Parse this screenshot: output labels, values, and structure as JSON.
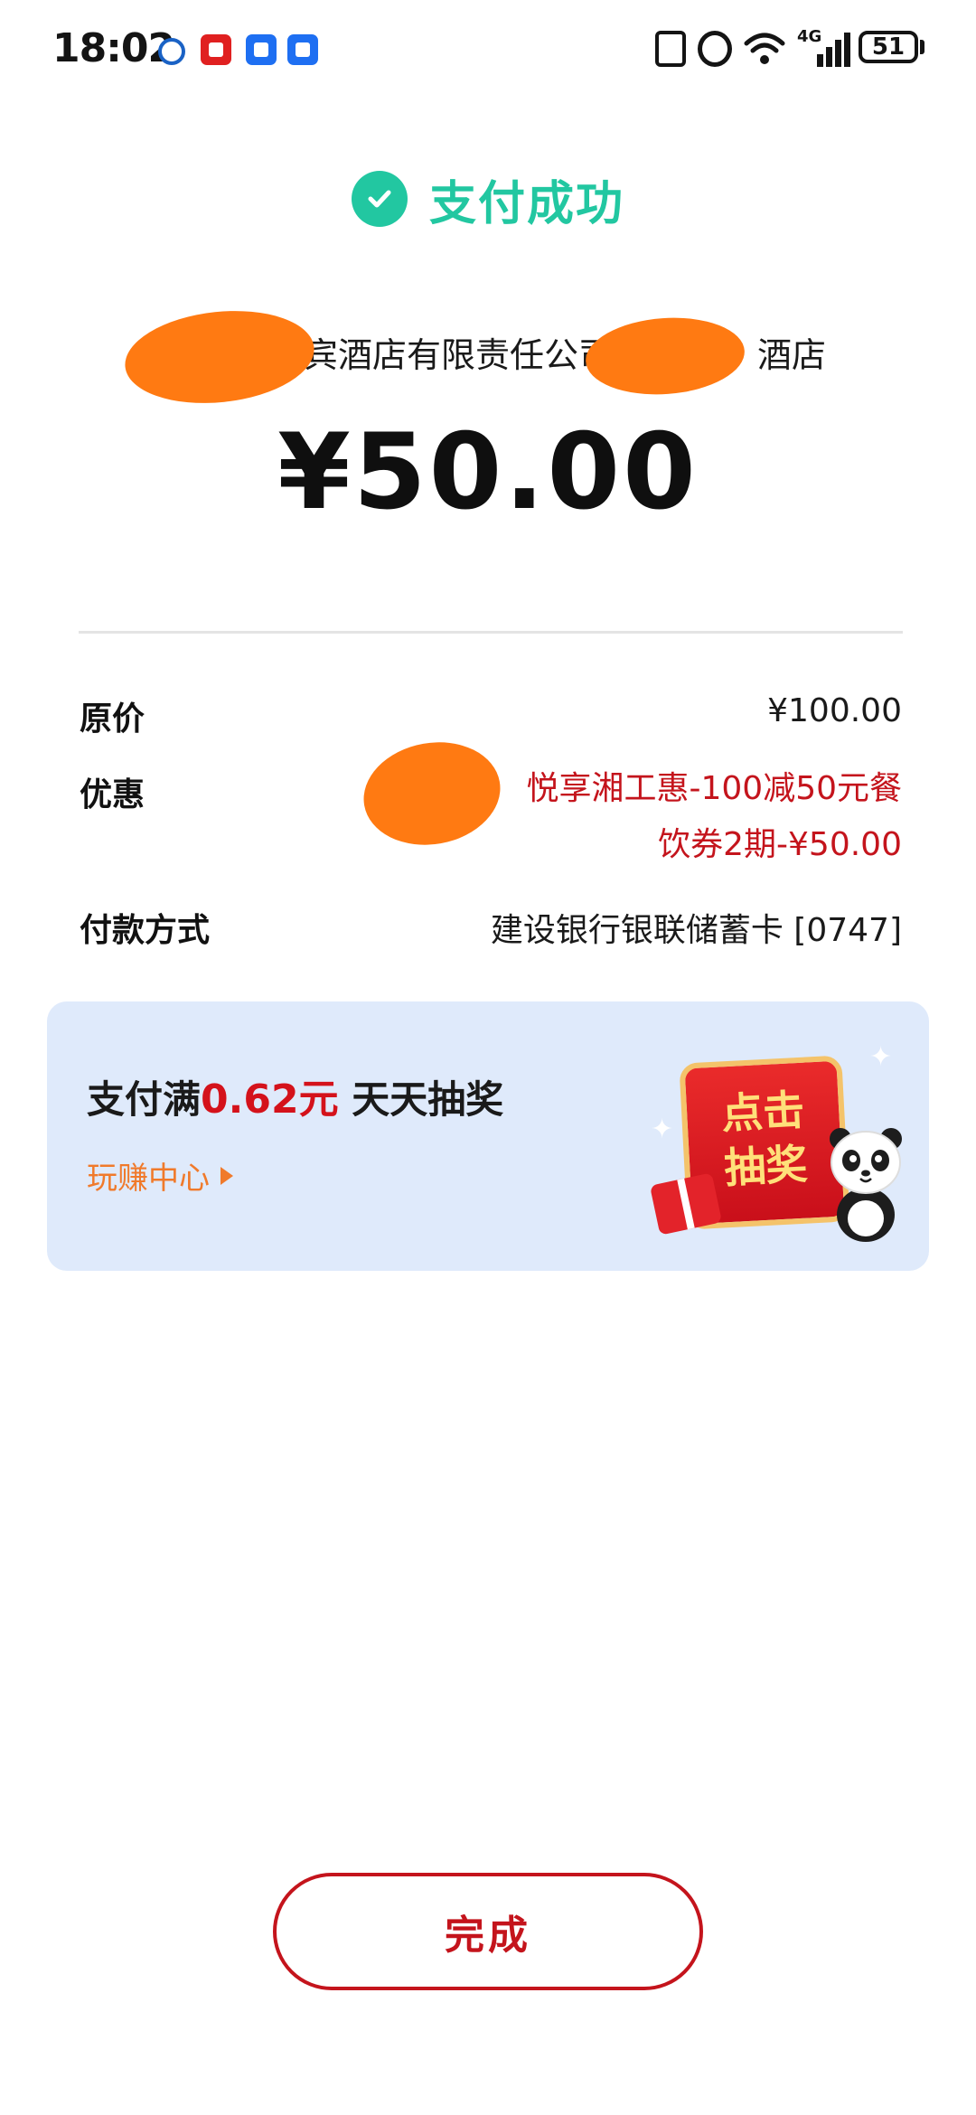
{
  "status_bar": {
    "time": "18:02",
    "network": "4G",
    "battery": "51"
  },
  "header": {
    "success_text": "支付成功"
  },
  "merchant": {
    "name_part1": "宾酒店有限责任公司",
    "name_part2": "酒店"
  },
  "amount": "¥50.00",
  "details": {
    "original_price_label": "原价",
    "original_price_value": "¥100.00",
    "discount_label": "优惠",
    "discount_value_line1": "悦享湘工惠-100减50元餐",
    "discount_value_line2": "饮券2期-¥50.00",
    "payment_method_label": "付款方式",
    "payment_method_value": "建设银行银联储蓄卡 [0747]"
  },
  "promo": {
    "title_prefix": "支付满",
    "title_amount": "0.62元",
    "title_suffix": " 天天抽奖",
    "link": "玩赚中心",
    "lottery_line1": "点击",
    "lottery_line2": "抽奖"
  },
  "done_button": "完成"
}
